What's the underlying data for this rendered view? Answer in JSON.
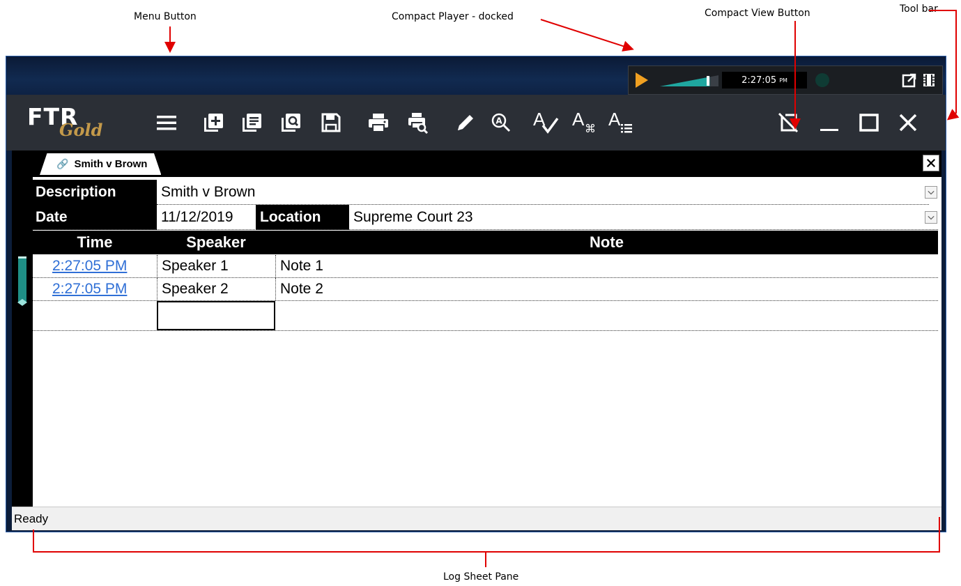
{
  "callouts": {
    "menu_button": "Menu Button",
    "compact_player": "Compact Player - docked",
    "compact_view_button": "Compact View Button",
    "tool_bar": "Tool bar",
    "log_sheet_pane": "Log Sheet Pane"
  },
  "player": {
    "time": "2:27:05",
    "ampm": "PM",
    "volume_level": 0.85
  },
  "logo": {
    "ftr": "FTR",
    "gold": "Gold"
  },
  "toolbar": {
    "icons": [
      "menu-icon",
      "new-log-icon",
      "open-log-icon",
      "find-log-icon",
      "save-icon",
      "print-icon",
      "print-preview-icon",
      "pencil-icon",
      "search-icon",
      "spell-check-icon",
      "text-shortcut-icon",
      "text-list-icon",
      "compact-view-icon",
      "minimize-icon",
      "maximize-icon",
      "close-icon"
    ]
  },
  "tab": {
    "label": "Smith v Brown"
  },
  "header": {
    "description_label": "Description",
    "description_value": "Smith v Brown",
    "date_label": "Date",
    "date_value": "11/12/2019",
    "location_label": "Location",
    "location_value": "Supreme Court 23"
  },
  "columns": {
    "time": "Time",
    "speaker": "Speaker",
    "note": "Note"
  },
  "rows": [
    {
      "time": "2:27:05 PM",
      "speaker": "Speaker 1",
      "note": "Note 1"
    },
    {
      "time": "2:27:05 PM",
      "speaker": "Speaker 2",
      "note": "Note 2"
    },
    {
      "time": "",
      "speaker": "",
      "note": ""
    }
  ],
  "status": {
    "text": "Ready"
  },
  "colors": {
    "accent_play": "#f0a021",
    "volume": "#1fa7a0",
    "logo_gold": "#c49a4a",
    "link": "#2f6fd6",
    "annotation": "#e00000"
  }
}
